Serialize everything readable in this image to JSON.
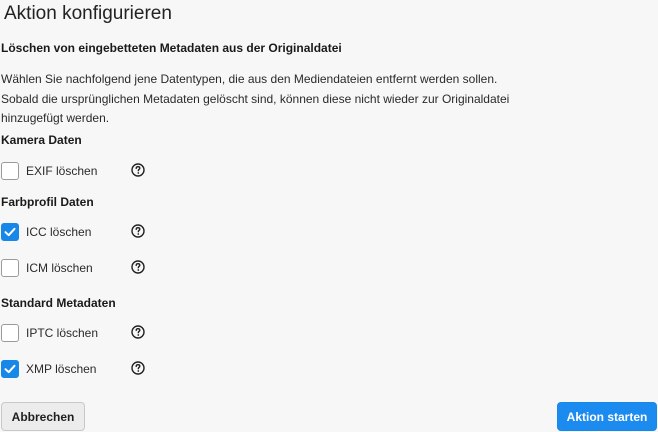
{
  "dialog": {
    "title": "Aktion konfigurieren",
    "subtitle": "Löschen von eingebetteten Metadaten aus der Originaldatei",
    "description_lines": [
      "Wählen Sie nachfolgend jene Datentypen, die aus den Mediendateien entfernt werden sollen.",
      "Sobald die ursprünglichen Metadaten gelöscht sind, können diese nicht wieder zur Originaldatei",
      "hinzugefügt werden."
    ]
  },
  "sections": [
    {
      "heading": "Kamera Daten",
      "options": [
        {
          "label": "EXIF löschen",
          "checked": false,
          "help_icon": "question-circle-icon"
        }
      ]
    },
    {
      "heading": "Farbprofil Daten",
      "options": [
        {
          "label": "ICC löschen",
          "checked": true,
          "help_icon": "question-circle-icon"
        },
        {
          "label": "ICM löschen",
          "checked": false,
          "help_icon": "question-circle-icon"
        }
      ]
    },
    {
      "heading": "Standard Metadaten",
      "options": [
        {
          "label": "IPTC löschen",
          "checked": false,
          "help_icon": "question-circle-icon"
        },
        {
          "label": "XMP löschen",
          "checked": true,
          "help_icon": "question-circle-icon"
        }
      ]
    }
  ],
  "footer": {
    "cancel_label": "Abbrechen",
    "start_label": "Aktion starten"
  },
  "colors": {
    "accent": "#1b8bf0",
    "background": "#f7f7f7"
  }
}
